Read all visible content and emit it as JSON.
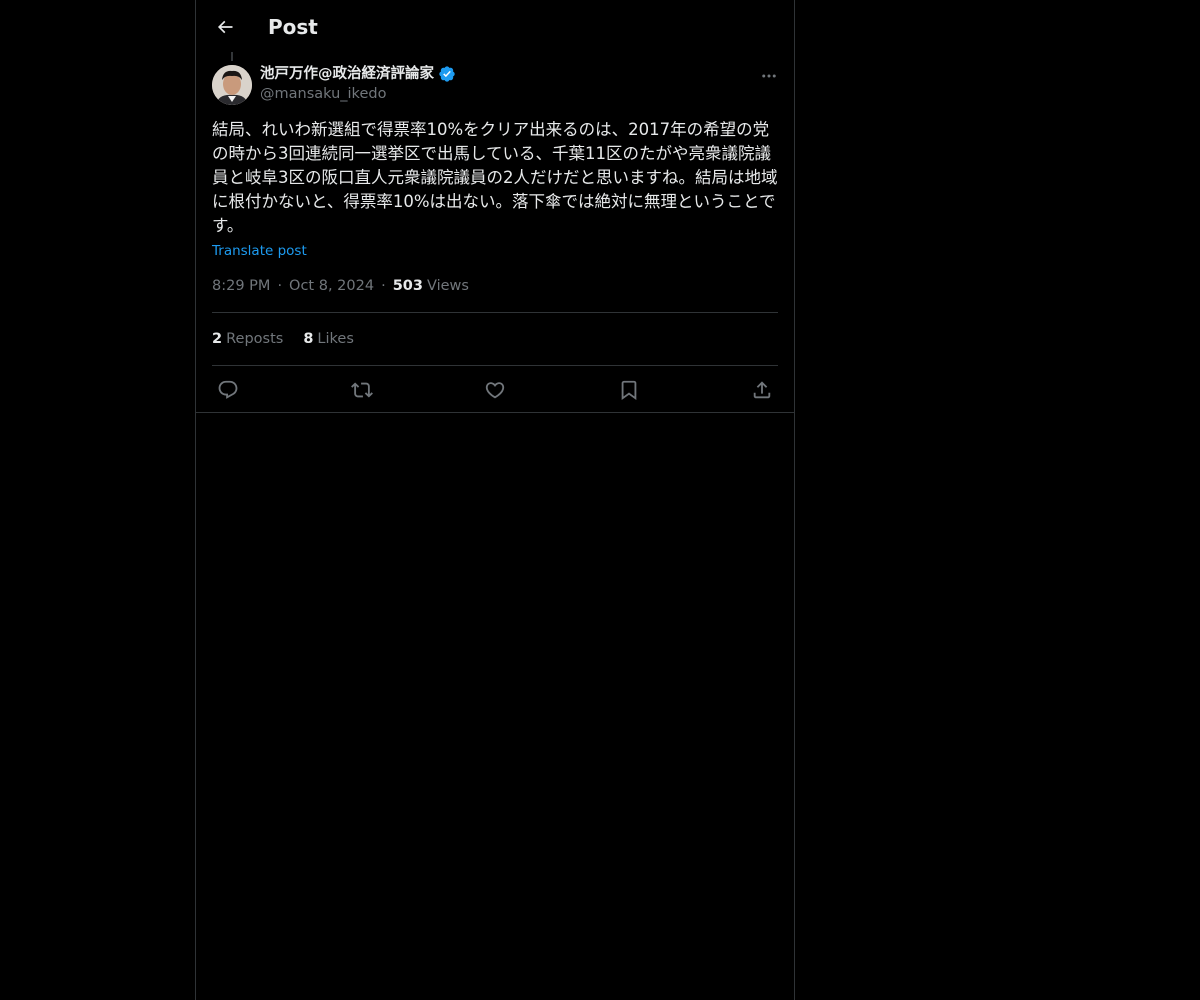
{
  "header": {
    "title": "Post",
    "back_icon": "arrow-left-icon"
  },
  "author": {
    "display_name": "池戸万作@政治経済評論家",
    "handle": "@mansaku_ikedo",
    "verified": true,
    "verified_color": "#1d9bf0"
  },
  "post": {
    "text": "結局、れいわ新選組で得票率10%をクリア出来るのは、2017年の希望の党の時から3回連続同一選挙区で出馬している、千葉11区のたがや亮衆議院議員と岐阜3区の阪口直人元衆議院議員の2人だけだと思いますね。結局は地域に根付かないと、得票率10%は出ない。落下傘では絶対に無理ということです。",
    "translate_label": "Translate post",
    "time": "8:29 PM",
    "date": "Oct 8, 2024",
    "separator": "·",
    "views_count": "503",
    "views_label": "Views"
  },
  "stats": {
    "reposts_count": "2",
    "reposts_label": "Reposts",
    "likes_count": "8",
    "likes_label": "Likes"
  },
  "actions": [
    "reply-icon",
    "repost-icon",
    "like-icon",
    "bookmark-icon",
    "share-icon"
  ],
  "colors": {
    "background": "#000000",
    "text": "#e7e9ea",
    "secondary": "#71767b",
    "accent": "#1d9bf0",
    "border": "#2f3336"
  }
}
